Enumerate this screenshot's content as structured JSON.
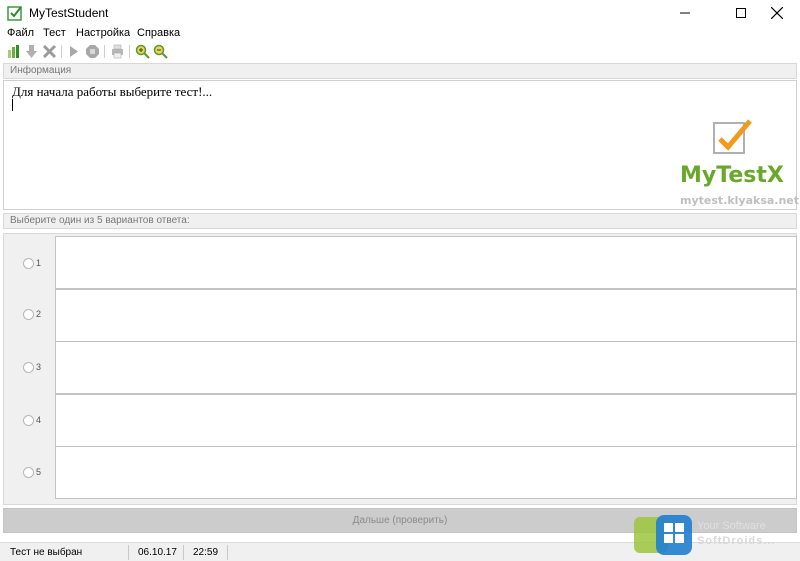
{
  "window": {
    "title": "MyTestStudent"
  },
  "menu": {
    "items": [
      "Файл",
      "Тест",
      "Настройка",
      "Справка"
    ]
  },
  "toolbar": {
    "icons": [
      "open-test-icon",
      "download-icon",
      "delete-icon",
      "play-icon",
      "stop-icon",
      "print-icon",
      "zoom-in-icon",
      "zoom-out-icon"
    ]
  },
  "info": {
    "header": "Информация",
    "text": "Для начала работы выберите тест!...",
    "logo_text": "MyTestX",
    "logo_url": "mytest.klyaksa.net"
  },
  "answers": {
    "header": "Выберите один из 5 вариантов ответа:",
    "options": [
      "1",
      "2",
      "3",
      "4",
      "5"
    ]
  },
  "next_button": {
    "label": "Дальше (проверить)"
  },
  "status": {
    "test": "Тест не выбран",
    "date": "06.10.17",
    "time": "22:59"
  },
  "watermark": {
    "line1": "Your Software",
    "line2": "SoftDroids..."
  },
  "colors": {
    "logo_green": "#6aa82c",
    "check_orange": "#f29a1d"
  }
}
